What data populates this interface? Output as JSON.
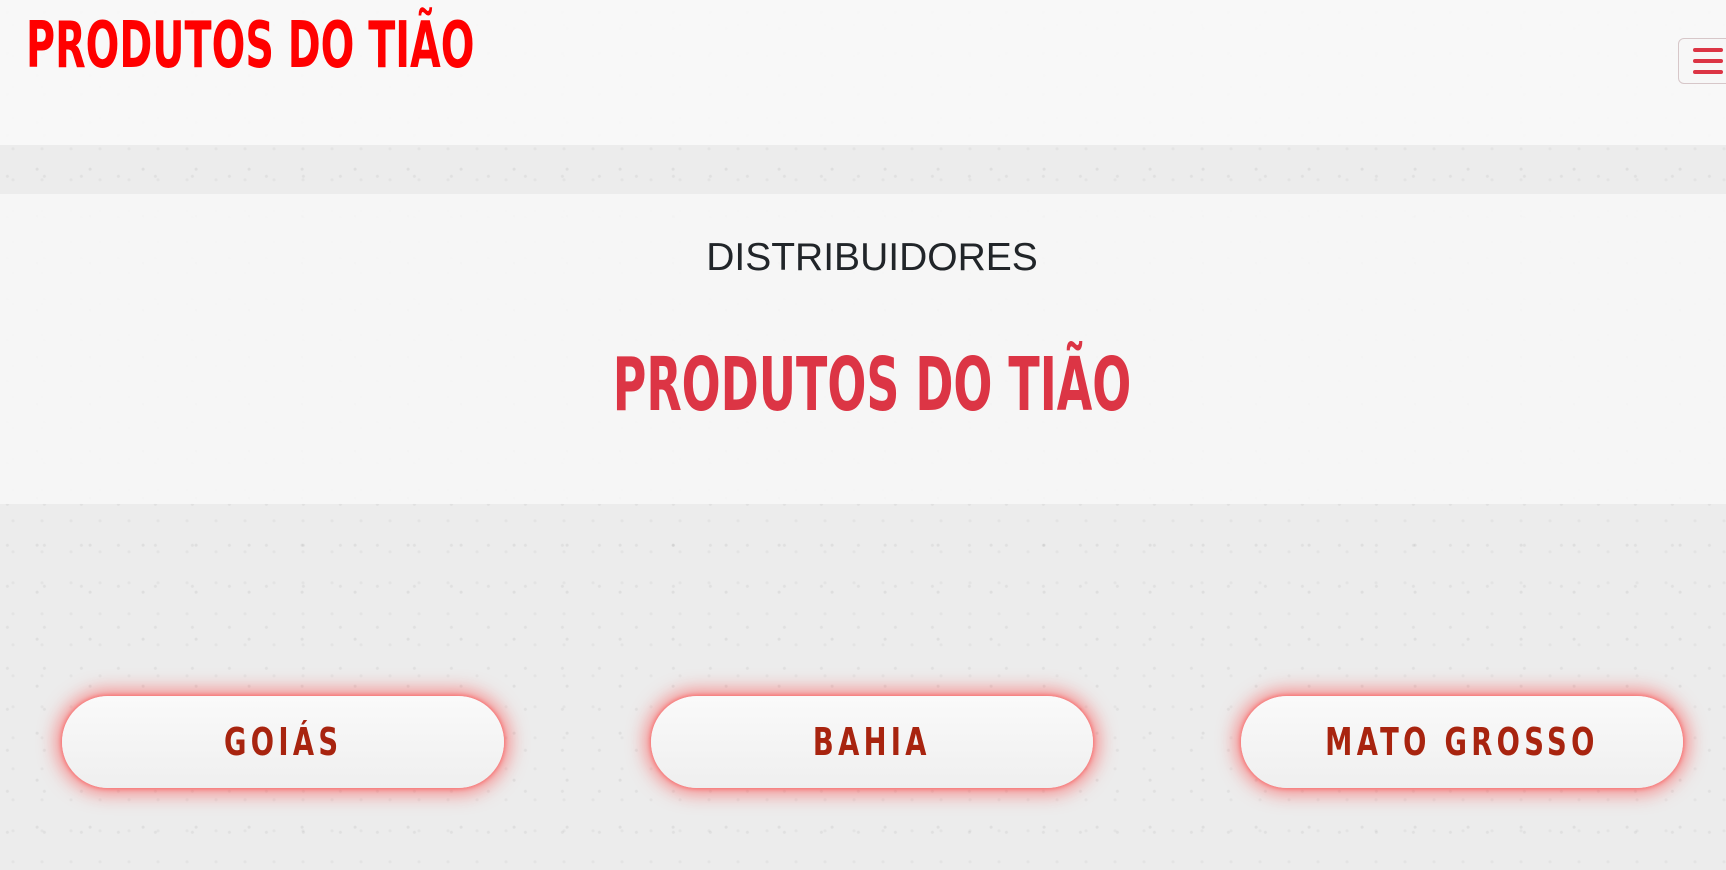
{
  "header": {
    "brand": "PRODUTOS DO TIÃO"
  },
  "hero": {
    "subtitle": "DISTRIBUIDORES",
    "title": "PRODUTOS DO TIÃO"
  },
  "regions": [
    {
      "label": "GOIÁS"
    },
    {
      "label": "BAHIA"
    },
    {
      "label": "MATO GROSSO"
    }
  ],
  "icons": {
    "menu": "hamburger-menu-icon"
  },
  "colors": {
    "brand_red": "#ff0000",
    "title_red": "#dc3545",
    "button_text": "#a8240f",
    "button_glow": "#ff3c3c"
  }
}
